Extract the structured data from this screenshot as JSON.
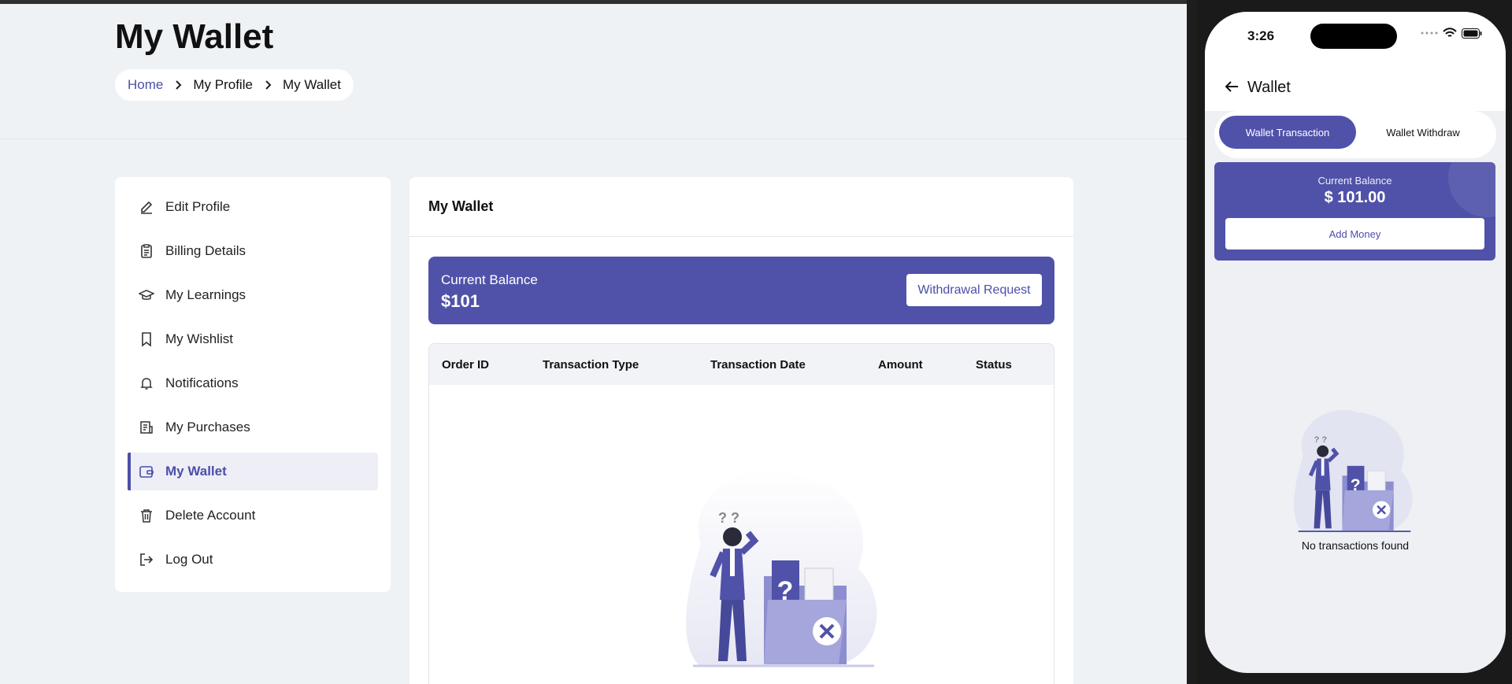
{
  "page": {
    "title": "My Wallet",
    "breadcrumb": [
      "Home",
      "My Profile",
      "My Wallet"
    ]
  },
  "sidebar": {
    "items": [
      {
        "label": "Edit Profile",
        "icon": "pencil-icon"
      },
      {
        "label": "Billing Details",
        "icon": "clipboard-icon"
      },
      {
        "label": "My Learnings",
        "icon": "graduation-cap-icon"
      },
      {
        "label": "My Wishlist",
        "icon": "bookmark-icon"
      },
      {
        "label": "Notifications",
        "icon": "bell-icon"
      },
      {
        "label": "My Purchases",
        "icon": "receipt-icon"
      },
      {
        "label": "My Wallet",
        "icon": "wallet-icon",
        "active": true
      },
      {
        "label": "Delete Account",
        "icon": "trash-icon"
      },
      {
        "label": "Log Out",
        "icon": "logout-icon"
      }
    ]
  },
  "main": {
    "header": "My Wallet",
    "balance_label": "Current Balance",
    "balance_value": "$101",
    "withdraw_label": "Withdrawal Request",
    "table_columns": [
      "Order ID",
      "Transaction Type",
      "Transaction Date",
      "Amount",
      "Status"
    ]
  },
  "phone": {
    "time": "3:26",
    "title": "Wallet",
    "tabs": [
      "Wallet Transaction",
      "Wallet Withdraw"
    ],
    "balance_label": "Current Balance",
    "balance_value": "$ 101.00",
    "add_money_label": "Add Money",
    "empty_text": "No transactions found"
  },
  "colors": {
    "accent": "#5052a9",
    "link": "#4b4fa8",
    "page_bg": "#eff2f5"
  }
}
